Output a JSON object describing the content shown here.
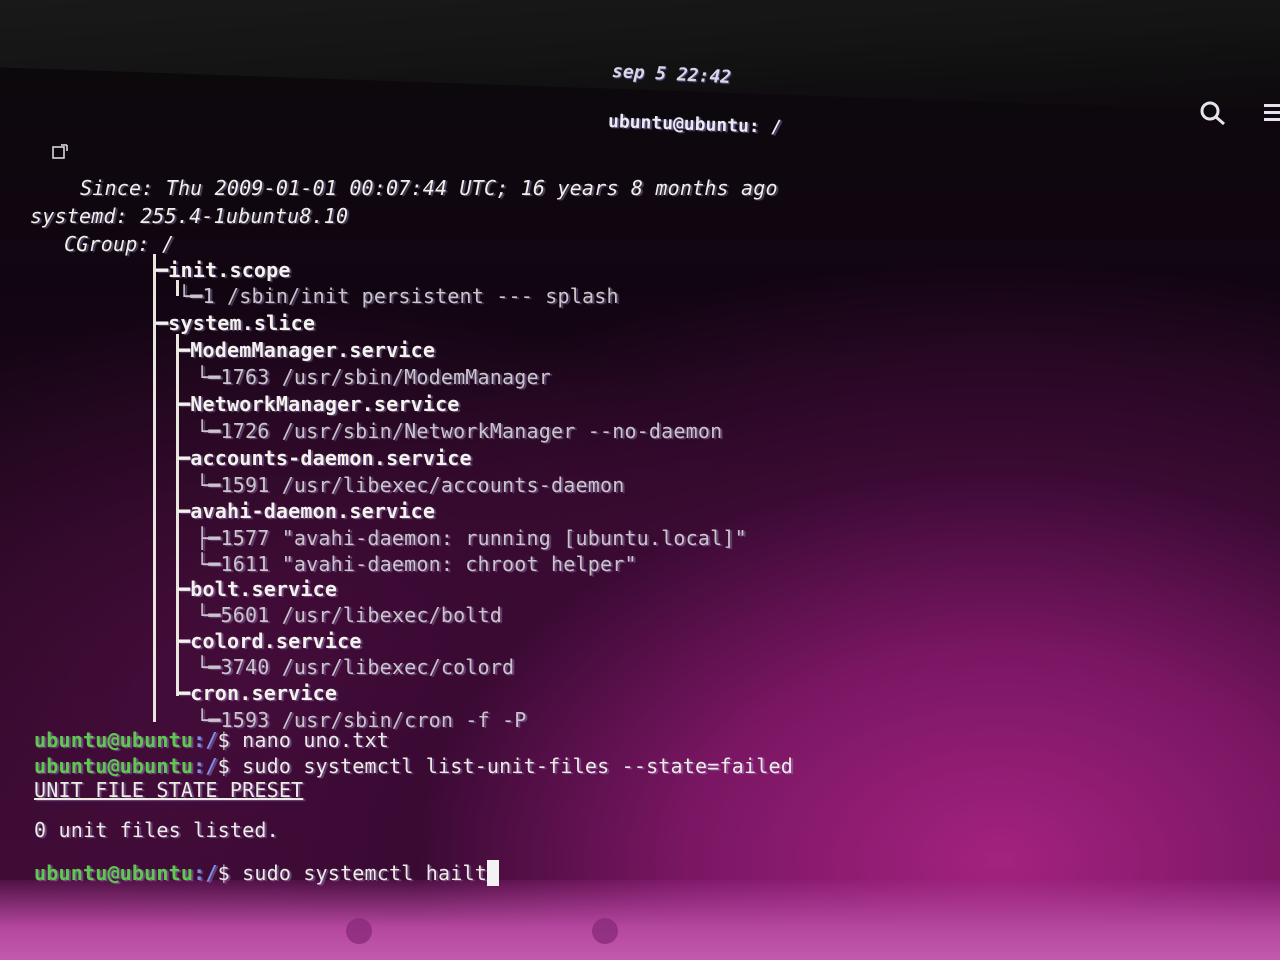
{
  "header": {
    "title": "sep 5 22:42",
    "path": "ubuntu@ubuntu: /"
  },
  "icons": {
    "new_tab": "new-tab-icon",
    "search": "search-icon",
    "menu": "hamburger-menu-icon"
  },
  "status": {
    "since_label": "Since:",
    "since_value": "Thu 2009-01-01 00:07:44 UTC; 16 years 8 months ago",
    "systemd_label": "systemd:",
    "systemd_value": "255.4-1ubuntu8.10",
    "cgroup_label": "CGroup:",
    "cgroup_value": "/"
  },
  "cgroup_tree": [
    {
      "kind": "unit",
      "text": "init.scope"
    },
    {
      "kind": "proc",
      "text": "1 /sbin/init persistent --- splash"
    },
    {
      "kind": "unit",
      "text": "system.slice"
    },
    {
      "kind": "unit",
      "text": "ModemManager.service"
    },
    {
      "kind": "proc",
      "text": "1763 /usr/sbin/ModemManager"
    },
    {
      "kind": "unit",
      "text": "NetworkManager.service"
    },
    {
      "kind": "proc",
      "text": "1726 /usr/sbin/NetworkManager --no-daemon"
    },
    {
      "kind": "unit",
      "text": "accounts-daemon.service"
    },
    {
      "kind": "proc",
      "text": "1591 /usr/libexec/accounts-daemon"
    },
    {
      "kind": "unit",
      "text": "avahi-daemon.service"
    },
    {
      "kind": "proc",
      "text": "1577 \"avahi-daemon: running [ubuntu.local]\""
    },
    {
      "kind": "proc",
      "text": "1611 \"avahi-daemon: chroot helper\""
    },
    {
      "kind": "unit",
      "text": "bolt.service"
    },
    {
      "kind": "proc",
      "text": "5601 /usr/libexec/boltd"
    },
    {
      "kind": "unit",
      "text": "colord.service"
    },
    {
      "kind": "proc",
      "text": "3740 /usr/libexec/colord"
    },
    {
      "kind": "unit",
      "text": "cron.service"
    },
    {
      "kind": "proc",
      "text": "1593 /usr/sbin/cron -f -P"
    }
  ],
  "prompt": {
    "user": "ubuntu@ubuntu",
    "path": ":/",
    "symbol": "$"
  },
  "commands": {
    "cmd1": " nano uno.txt",
    "cmd2": " sudo systemctl list-unit-files --state=failed",
    "cmd3": " sudo systemctl hailt"
  },
  "output": {
    "table_header": "UNIT FILE STATE PRESET",
    "result": "0 unit files listed."
  },
  "colors": {
    "prompt_user": "#5ec94f",
    "prompt_path": "#7b8ff0",
    "background": "#3a0a33"
  }
}
